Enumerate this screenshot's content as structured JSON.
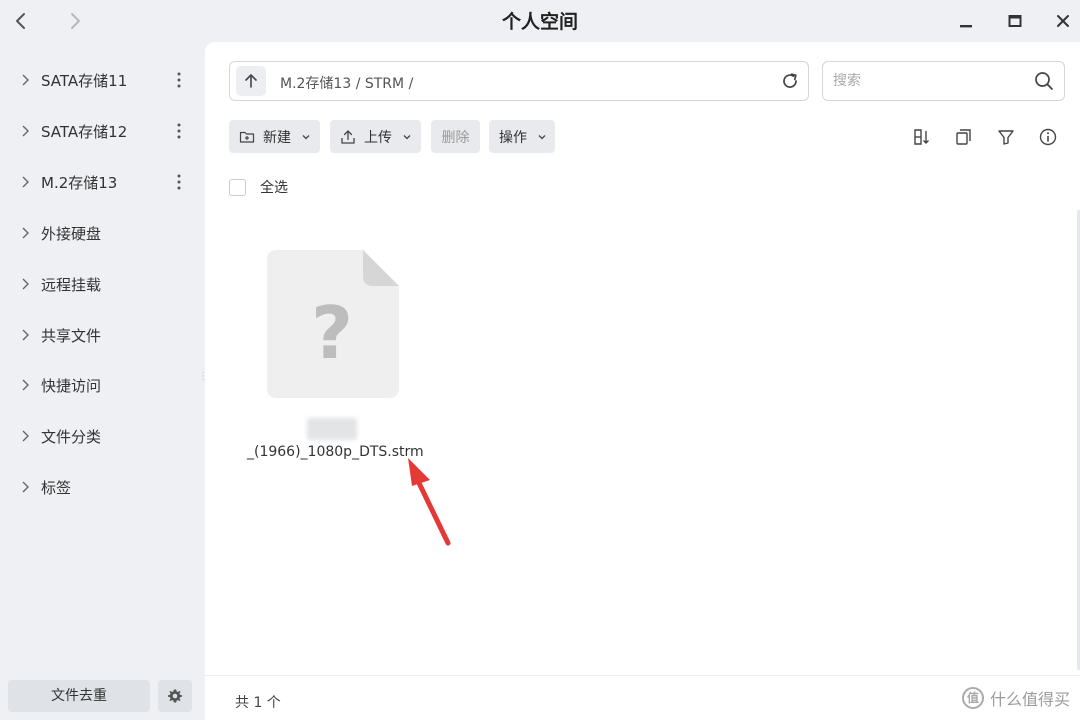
{
  "window": {
    "title": "个人空间"
  },
  "sidebar": {
    "items": [
      {
        "label": "SATA存储11",
        "has_menu": true
      },
      {
        "label": "SATA存储12",
        "has_menu": true
      },
      {
        "label": "M.2存储13",
        "has_menu": true
      },
      {
        "label": "外接硬盘",
        "has_menu": false
      },
      {
        "label": "远程挂载",
        "has_menu": false
      },
      {
        "label": "共享文件",
        "has_menu": false
      },
      {
        "label": "快捷访问",
        "has_menu": false
      },
      {
        "label": "文件分类",
        "has_menu": false
      },
      {
        "label": "标签",
        "has_menu": false
      }
    ],
    "dedupe_label": "文件去重"
  },
  "pathbar": {
    "path": "M.2存储13 / STRM /"
  },
  "search": {
    "placeholder": "搜索",
    "value": ""
  },
  "toolbar": {
    "new_label": "新建",
    "upload_label": "上传",
    "delete_label": "删除",
    "actions_label": "操作"
  },
  "select_all_label": "全选",
  "files": [
    {
      "name": "_(1966)_1080p_DTS.strm",
      "icon": "unknown-file-icon"
    }
  ],
  "footer": {
    "count": "共 1 个"
  },
  "watermark": {
    "logo": "值",
    "text": "什么值得买"
  },
  "colors": {
    "background": "#eef0f3",
    "panel": "#ffffff",
    "button": "#e8eaed",
    "annotation_arrow": "#e53935"
  }
}
